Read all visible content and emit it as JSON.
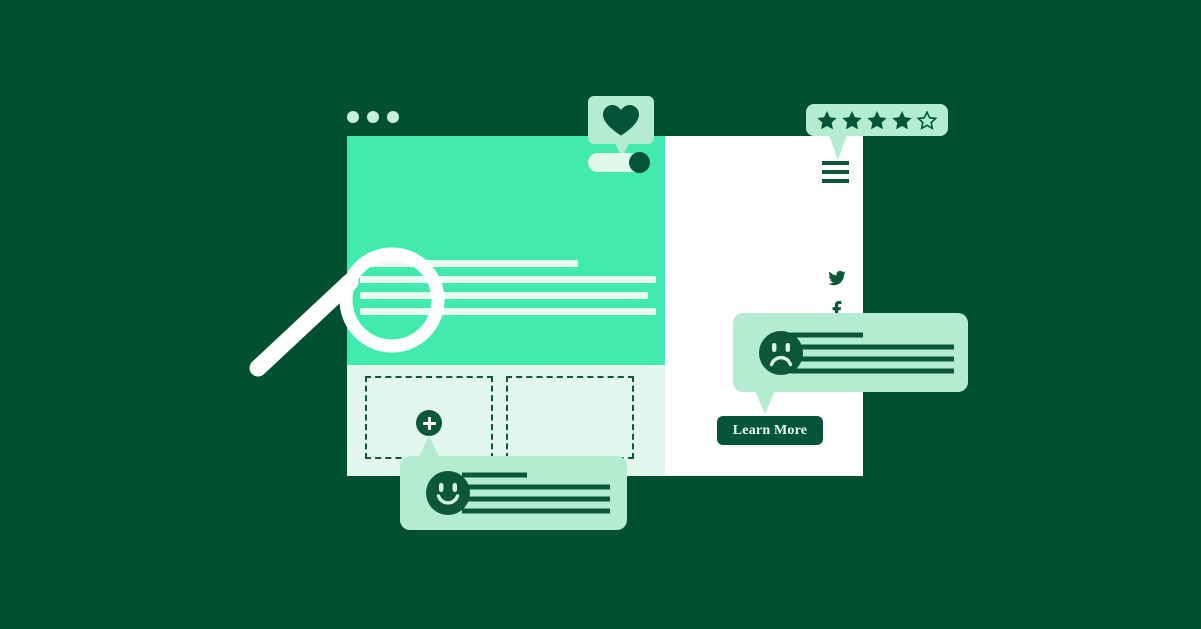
{
  "theme": {
    "background": "#01502f",
    "hero_green": "#43eaae",
    "panel_light": "#e2f7ed",
    "panel_white": "#ffffff",
    "bubble_mint": "#b4ecd1",
    "dark_green": "#04543a",
    "accent_white": "#eafdf5"
  },
  "window": {
    "dots": [
      "window-dot-1",
      "window-dot-2",
      "window-dot-3"
    ]
  },
  "left_panel": {
    "hero_text_lines": [
      {
        "id": "hero-line-1",
        "width_pct": 74
      },
      {
        "id": "hero-line-2",
        "width_pct": 100
      },
      {
        "id": "hero-line-3",
        "width_pct": 97
      },
      {
        "id": "hero-line-4",
        "width_pct": 100
      }
    ],
    "placeholder_boxes": [
      {
        "id": "placeholder-box-left"
      },
      {
        "id": "placeholder-box-right"
      }
    ],
    "add_badge": {
      "icon": "plus-icon",
      "label": "+"
    },
    "magnifier": {
      "icon": "magnifying-glass-icon"
    }
  },
  "right_panel": {
    "menu": {
      "icon": "hamburger-menu-icon"
    },
    "social_links": [
      {
        "id": "twitter-link",
        "icon": "twitter-icon",
        "label": "Twitter"
      },
      {
        "id": "facebook-link",
        "icon": "facebook-icon",
        "label": "Facebook"
      }
    ]
  },
  "heart_widget": {
    "icon": "heart-icon",
    "toggle": {
      "id": "favorite-toggle",
      "state": "on"
    }
  },
  "rating": {
    "icon": "star-icon",
    "total": 5,
    "filled": 4,
    "value": "4 out of 5"
  },
  "feedback_negative": {
    "face_icon": "sad-face-icon",
    "text_lines": [
      {
        "id": "sad-line-1",
        "width_pct": 45
      },
      {
        "id": "sad-line-2",
        "width_pct": 100
      },
      {
        "id": "sad-line-3",
        "width_pct": 100
      },
      {
        "id": "sad-line-4",
        "width_pct": 100
      }
    ],
    "cta_label": "Learn More"
  },
  "feedback_positive": {
    "face_icon": "happy-face-icon",
    "text_lines": [
      {
        "id": "happy-line-1",
        "width_pct": 44
      },
      {
        "id": "happy-line-2",
        "width_pct": 100
      },
      {
        "id": "happy-line-3",
        "width_pct": 100
      },
      {
        "id": "happy-line-4",
        "width_pct": 100
      }
    ]
  }
}
